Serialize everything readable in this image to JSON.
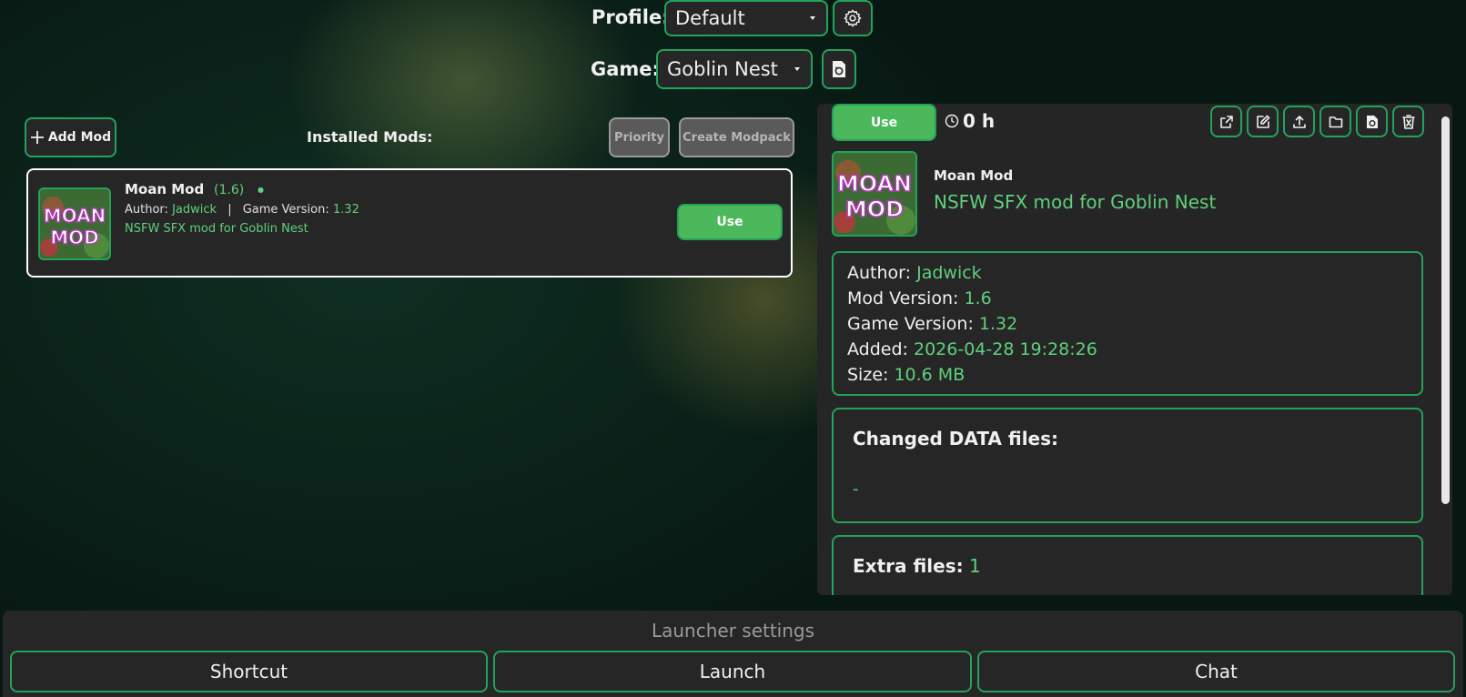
{
  "header": {
    "profile_label": "Profile:",
    "profile_value": "Default",
    "game_label": "Game:",
    "game_value": "Goblin Nest"
  },
  "left": {
    "add_mod_label": "Add Mod",
    "installed_label": "Installed Mods:",
    "priority_label": "Priority",
    "create_modpack_label": "Create Modpack",
    "mods": [
      {
        "name": "Moan Mod",
        "version": "(1.6)",
        "status_dot": "●",
        "author_label": "Author:",
        "author": "Jadwick",
        "separator": "|",
        "game_version_label": "Game Version:",
        "game_version": "1.32",
        "description": "NSFW SFX mod for Goblin Nest",
        "use_label": "Use",
        "logo_text_top": "MOAN",
        "logo_text_bottom": "MOD"
      }
    ]
  },
  "details": {
    "use_label": "Use",
    "playtime": "0 h",
    "name": "Moan Mod",
    "description": "NSFW SFX mod for Goblin Nest",
    "logo_text_top": "MOAN",
    "logo_text_bottom": "MOD",
    "author_label": "Author:",
    "author": "Jadwick",
    "mod_version_label": "Mod Version:",
    "mod_version": "1.6",
    "game_version_label": "Game Version:",
    "game_version": "1.32",
    "added_label": "Added:",
    "added": "2026-04-28 19:28:26",
    "size_label": "Size:",
    "size": "10.6 MB",
    "changed_data_label": "Changed DATA files:",
    "changed_data_value": "-",
    "extra_files_label": "Extra files:",
    "extra_files_value": "1",
    "icons": [
      "external-link-icon",
      "edit-icon",
      "upload-icon",
      "folder-icon",
      "file-refresh-icon",
      "trash-icon"
    ]
  },
  "footer": {
    "launcher_settings": "Launcher settings",
    "shortcut_label": "Shortcut",
    "launch_label": "Launch",
    "chat_label": "Chat"
  },
  "colors": {
    "accent": "#23a35a",
    "green_text": "#5fd07d",
    "use_button": "#4cb85c",
    "panel": "#252525"
  }
}
